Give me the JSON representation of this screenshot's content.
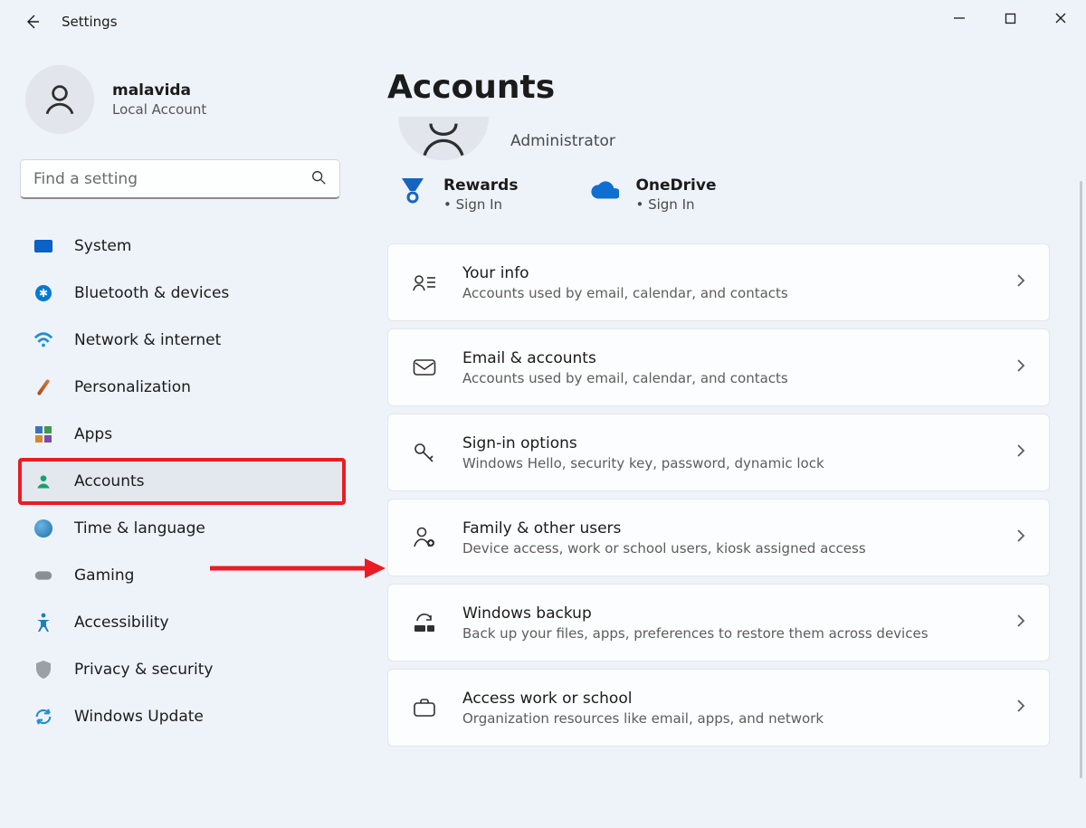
{
  "titlebar": {
    "title": "Settings"
  },
  "user": {
    "name": "malavida",
    "type": "Local Account"
  },
  "search": {
    "placeholder": "Find a setting"
  },
  "nav": {
    "items": [
      {
        "label": "System",
        "icon": "system-icon"
      },
      {
        "label": "Bluetooth & devices",
        "icon": "bluetooth-icon"
      },
      {
        "label": "Network & internet",
        "icon": "wifi-icon"
      },
      {
        "label": "Personalization",
        "icon": "paintbrush-icon"
      },
      {
        "label": "Apps",
        "icon": "apps-icon"
      },
      {
        "label": "Accounts",
        "icon": "person-icon"
      },
      {
        "label": "Time & language",
        "icon": "globe-clock-icon"
      },
      {
        "label": "Gaming",
        "icon": "gamepad-icon"
      },
      {
        "label": "Accessibility",
        "icon": "accessibility-icon"
      },
      {
        "label": "Privacy & security",
        "icon": "shield-icon"
      },
      {
        "label": "Windows Update",
        "icon": "update-icon"
      }
    ],
    "selected_index": 5
  },
  "page": {
    "title": "Accounts",
    "role": "Administrator",
    "promos": [
      {
        "title": "Rewards",
        "sub": "Sign In",
        "icon": "rewards-icon"
      },
      {
        "title": "OneDrive",
        "sub": "Sign In",
        "icon": "onedrive-icon"
      }
    ],
    "cards": [
      {
        "title": "Your info",
        "desc": "Accounts used by email, calendar, and contacts",
        "icon": "your-info-icon"
      },
      {
        "title": "Email & accounts",
        "desc": "Accounts used by email, calendar, and contacts",
        "icon": "mail-icon"
      },
      {
        "title": "Sign-in options",
        "desc": "Windows Hello, security key, password, dynamic lock",
        "icon": "key-icon"
      },
      {
        "title": "Family & other users",
        "desc": "Device access, work or school users, kiosk assigned access",
        "icon": "family-icon"
      },
      {
        "title": "Windows backup",
        "desc": "Back up your files, apps, preferences to restore them across devices",
        "icon": "backup-icon"
      },
      {
        "title": "Access work or school",
        "desc": "Organization resources like email, apps, and network",
        "icon": "briefcase-icon"
      }
    ]
  },
  "annotation": {
    "highlight_nav_index": 5,
    "arrow_target_card_index": 3
  }
}
